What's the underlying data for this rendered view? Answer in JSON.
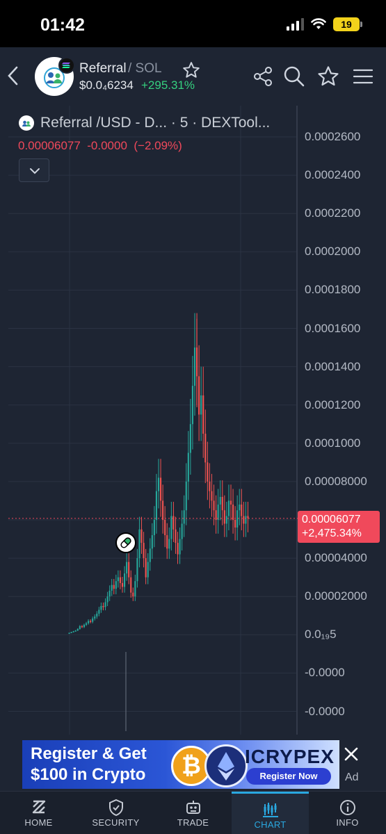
{
  "status_bar": {
    "time": "01:42",
    "battery": "19"
  },
  "header": {
    "token_name": "Referral",
    "chain": "/ SOL",
    "price": "$0.0₄6234",
    "change": "+295.31%"
  },
  "chart": {
    "title": "Referral /USD - D... · 5 · DEXTool...",
    "ohlc": "0.00006077  -0.0000  (−2.09%)",
    "price_tag_value": "0.00006077",
    "price_tag_change": "+2,475.34%",
    "y_axis_labels": [
      "0.0002600",
      "0.0002400",
      "0.0002200",
      "0.0002000",
      "0.0001800",
      "0.0001600",
      "0.0001400",
      "0.0001200",
      "0.0001000",
      "0.00008000",
      "0.00006000",
      "0.00004000",
      "0.00002000",
      "0.0₁₉5",
      "-0.0000",
      "-0.0000"
    ],
    "up_color": "#26a69a",
    "down_color": "#ef5350",
    "last_price_color": "#f0495b"
  },
  "chart_data": {
    "type": "candlestick",
    "x": [
      1,
      2,
      3,
      4,
      5,
      6,
      7,
      8,
      9,
      10,
      11,
      12,
      13,
      14,
      15,
      16,
      17,
      18,
      19,
      20,
      21,
      22,
      23,
      24,
      25,
      26,
      27,
      28,
      29,
      30,
      31,
      32,
      33,
      34,
      35,
      36,
      37,
      38,
      39,
      40,
      41,
      42,
      43,
      44,
      45,
      46,
      47,
      48,
      49,
      50,
      51,
      52,
      53,
      54,
      55,
      56,
      57,
      58,
      59,
      60,
      61,
      62,
      63,
      64,
      65,
      66,
      67,
      68,
      69,
      70,
      71,
      72,
      73,
      74,
      75,
      76,
      77,
      78,
      79,
      80,
      81,
      82,
      83,
      84,
      85
    ],
    "close": [
      1e-06,
      1.4e-06,
      1.8e-06,
      2.2e-06,
      3e-06,
      4.5e-06,
      4e-06,
      5.2e-06,
      6e-06,
      7.2e-06,
      6.8e-06,
      8.5e-06,
      9.5e-06,
      1.1e-05,
      1.3e-05,
      1.5e-05,
      1.45e-05,
      1.7e-05,
      2e-05,
      2.3e-05,
      2.6e-05,
      2.4e-05,
      2.8e-05,
      3e-05,
      2.7e-05,
      2.5e-05,
      3.2e-05,
      3.8e-05,
      3e-05,
      2.2e-05,
      2e-05,
      2.8e-05,
      4e-05,
      5.5e-05,
      4.8e-05,
      4e-05,
      3e-05,
      3.8e-05,
      4.5e-05,
      5.2e-05,
      6e-05,
      7.5e-05,
      8.2e-05,
      7e-05,
      6e-05,
      5.2e-05,
      4.5e-05,
      5e-05,
      6.2e-05,
      5.5e-05,
      4.8e-05,
      4.2e-05,
      5e-05,
      5.8e-05,
      6.5e-05,
      8e-05,
      9.5e-05,
      0.00011,
      0.00013,
      0.00015,
      0.000135,
      0.000115,
      0.000125,
      0.000105,
      9e-05,
      8e-05,
      7.5e-05,
      7e-05,
      6.5e-05,
      6e-05,
      6.8e-05,
      7.2e-05,
      6.5e-05,
      5.8e-05,
      6.2e-05,
      7e-05,
      6.8e-05,
      6e-05,
      5.6e-05,
      6.5e-05,
      6.8e-05,
      6.2e-05,
      5.8e-05,
      6.2e-05,
      6.08e-05
    ],
    "low_wick_min": 0.0,
    "high_wick_max": 0.000165,
    "ylim": [
      -4e-05,
      0.00027
    ],
    "last_price": 6.077e-05,
    "grid": true
  },
  "ad": {
    "line1": "Register & Get",
    "line2": "$100 in Crypto",
    "brand": "ICRYPEX",
    "cta": "Register Now",
    "label": "Ad"
  },
  "nav": {
    "items": [
      {
        "label": "HOME",
        "icon": "home-icon"
      },
      {
        "label": "SECURITY",
        "icon": "shield-icon"
      },
      {
        "label": "TRADE",
        "icon": "robot-icon"
      },
      {
        "label": "CHART",
        "icon": "chart-icon"
      },
      {
        "label": "INFO",
        "icon": "info-icon"
      }
    ]
  }
}
